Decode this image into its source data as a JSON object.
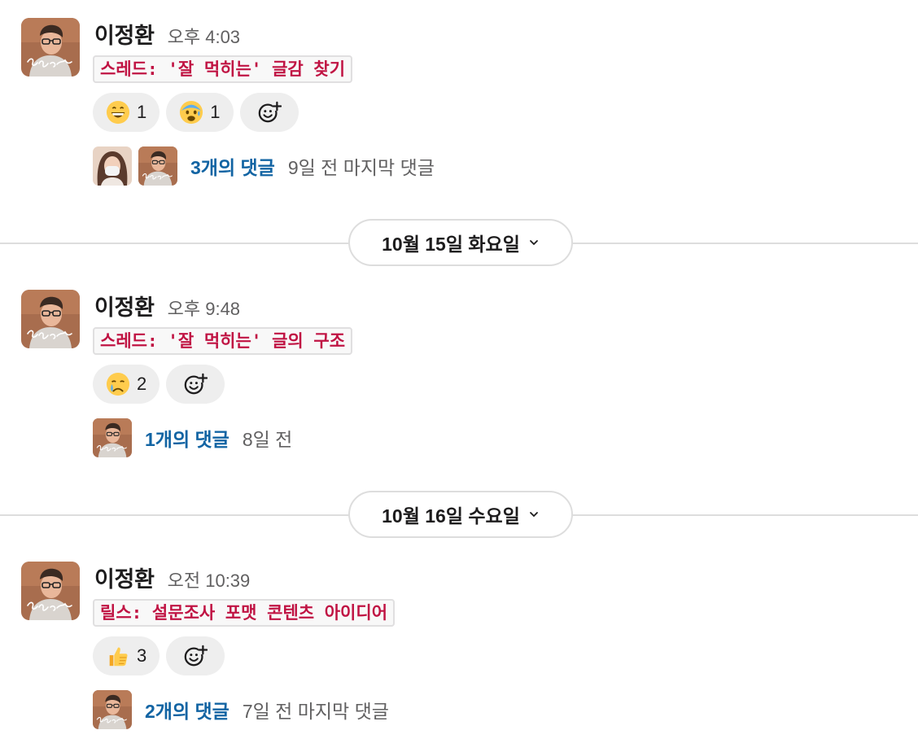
{
  "messages": [
    {
      "author": "이정환",
      "time": "오후 4:03",
      "code": "스레드: '잘 먹히는' 글감 찾기",
      "reactions": [
        {
          "emoji": "grinning-face-emoji",
          "count": "1"
        },
        {
          "emoji": "anxious-face-emoji",
          "count": "1"
        }
      ],
      "thread": {
        "replies": "3개의 댓글",
        "meta": "9일 전 마지막 댓글"
      }
    },
    {
      "author": "이정환",
      "time": "오후 9:48",
      "code": "스레드: '잘 먹히는' 글의 구조",
      "reactions": [
        {
          "emoji": "crying-face-emoji",
          "count": "2"
        }
      ],
      "thread": {
        "replies": "1개의 댓글",
        "meta": "8일 전"
      }
    },
    {
      "author": "이정환",
      "time": "오전 10:39",
      "code": "릴스: 설문조사 포맷 콘텐츠 아이디어",
      "reactions": [
        {
          "emoji": "thumbs-up-emoji",
          "count": "3"
        }
      ],
      "thread": {
        "replies": "2개의 댓글",
        "meta": "7일 전 마지막 댓글"
      }
    }
  ],
  "dividers": [
    {
      "label": "10월 15일 화요일",
      "icon": "chevron-down-icon"
    },
    {
      "label": "10월 16일 수요일",
      "icon": "chevron-down-icon"
    }
  ],
  "icons": {
    "add_reaction": "add-reaction-icon",
    "avatar": "avatar"
  },
  "colors": {
    "link": "#1264a3",
    "code_text": "#c01343",
    "muted": "#616061",
    "reaction_bg": "#eeeeee"
  }
}
